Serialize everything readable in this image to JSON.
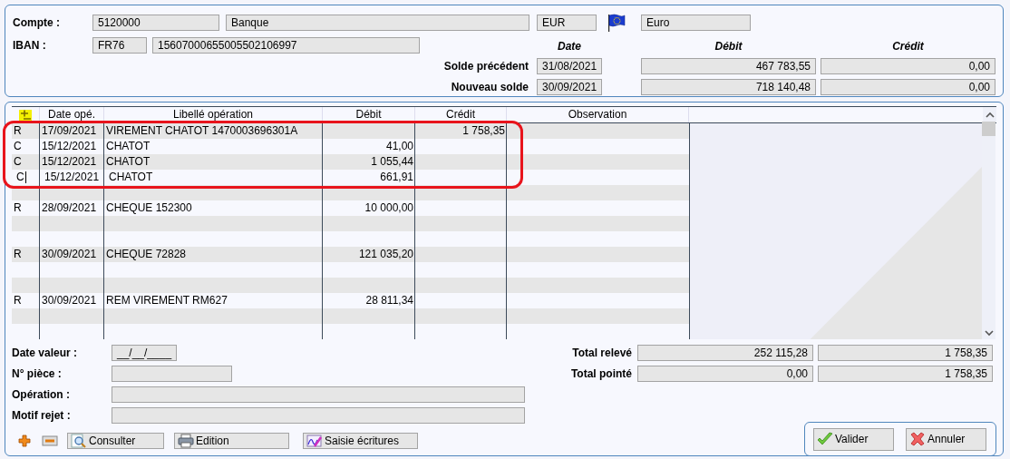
{
  "account": {
    "label": "Compte :",
    "number": "5120000",
    "name": "Banque",
    "currency_code": "EUR",
    "currency_name": "Euro"
  },
  "iban": {
    "label": "IBAN :",
    "prefix": "FR76",
    "number": "15607000655005502106997"
  },
  "balances": {
    "headers": [
      "Date",
      "Débit",
      "Crédit"
    ],
    "rows": [
      {
        "label": "Solde précédent",
        "date": "31/08/2021",
        "debit": "467 783,55",
        "credit": "0,00"
      },
      {
        "label": "Nouveau solde",
        "date": "30/09/2021",
        "debit": "718 140,48",
        "credit": "0,00"
      }
    ]
  },
  "table": {
    "columns": [
      "Date opé.",
      "Libellé opération",
      "Débit",
      "Crédit",
      "Observation"
    ],
    "rows": [
      {
        "kind": "entry",
        "status": "R",
        "date": "17/09/2021",
        "label": "VIREMENT CHATOT 1470003696301A",
        "credit": "1 758,35",
        "highlighted": true,
        "editing": false
      },
      {
        "kind": "entry",
        "status": "C",
        "date": "15/12/2021",
        "label": "CHATOT",
        "debit": "41,00",
        "highlighted": true,
        "editing": false
      },
      {
        "kind": "entry",
        "status": "C",
        "date": "15/12/2021",
        "label": "CHATOT",
        "debit": "1 055,44",
        "highlighted": true,
        "editing": false
      },
      {
        "kind": "entry",
        "status": "C",
        "date": "15/12/2021",
        "label": "CHATOT",
        "debit": "661,91",
        "highlighted": true,
        "editing": true
      },
      {
        "kind": "blank",
        "highlighted": false
      },
      {
        "kind": "entry",
        "status": "R",
        "date": "28/09/2021",
        "label": "CHEQUE 152300",
        "debit": "10 000,00",
        "highlighted": false,
        "editing": false
      },
      {
        "kind": "blank",
        "highlighted": false
      },
      {
        "kind": "blank",
        "highlighted": false
      },
      {
        "kind": "entry",
        "status": "R",
        "date": "30/09/2021",
        "label": "CHEQUE 72828",
        "debit": "121 035,20",
        "highlighted": false,
        "editing": false
      },
      {
        "kind": "blank",
        "highlighted": false
      },
      {
        "kind": "blank",
        "highlighted": false
      },
      {
        "kind": "entry",
        "status": "R",
        "date": "30/09/2021",
        "label": "REM VIREMENT RM627",
        "debit": "28 811,34",
        "highlighted": false,
        "editing": false
      },
      {
        "kind": "blank",
        "highlighted": false
      },
      {
        "kind": "blank",
        "highlighted": false
      }
    ]
  },
  "form": [
    {
      "label": "Date valeur :",
      "kind": "date",
      "value": "__/__/____"
    },
    {
      "label": "N° pièce :",
      "kind": "short"
    },
    {
      "label": "Opération :",
      "kind": "long"
    },
    {
      "label": "Motif rejet :",
      "kind": "long"
    }
  ],
  "totals": [
    {
      "label": "Total relevé",
      "debit": "252 115,28",
      "credit": "1 758,35"
    },
    {
      "label": "Total pointé",
      "debit": "0,00",
      "credit": "1 758,35"
    }
  ],
  "actions": [
    {
      "label": "Consulter",
      "kind": "consult"
    },
    {
      "label": "Edition",
      "kind": "print"
    },
    {
      "label": "Saisie écritures",
      "kind": "entries"
    }
  ],
  "dialog_buttons": [
    {
      "label": "Valider",
      "kind": "confirm"
    },
    {
      "label": "Annuler",
      "kind": "cancel"
    }
  ]
}
